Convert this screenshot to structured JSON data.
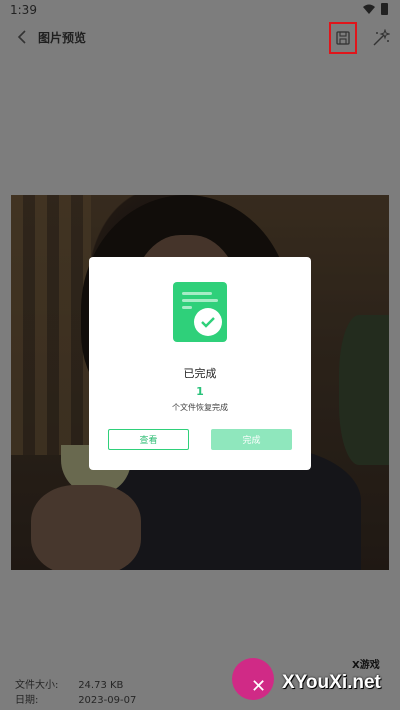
{
  "status_bar": {
    "time": "1:39"
  },
  "header": {
    "title": "图片预览",
    "back_icon": "chevron-left-icon",
    "save_icon": "floppy-disk-icon",
    "enhance_icon": "magic-wand-icon"
  },
  "dialog": {
    "icon": "document-check-icon",
    "title": "已完成",
    "count": "1",
    "message": "个文件恢复完成",
    "view_label": "查看",
    "done_label": "完成"
  },
  "file_info": {
    "size_label": "文件大小:",
    "size_value": "24.73 KB",
    "date_label": "日期:",
    "date_value": "2023-09-07"
  },
  "watermark": {
    "cn": "X游戏",
    "site": "XYouXi.net"
  },
  "colors": {
    "accent": "#2fd07a",
    "highlight_box": "#e0151b",
    "background": "#7d7d7d"
  }
}
